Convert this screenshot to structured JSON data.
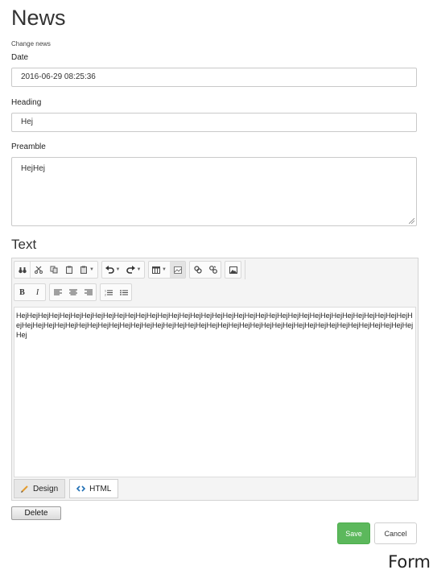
{
  "page": {
    "title": "News",
    "subtitle": "Change news"
  },
  "form": {
    "date_label": "Date",
    "date_value": "2016-06-29 08:25:36",
    "heading_label": "Heading",
    "heading_value": "Hej",
    "preamble_label": "Preamble",
    "preamble_value": "HejHej"
  },
  "editor": {
    "section_title": "Text",
    "content": "HejHejHejHejHejHejHejHejHejHejHejHejHejHejHejHejHejHejHejHejHejHejHejHejHejHejHejHejHejHejHejHejHejHejHejHejHejHejHejHejHejHejHejHejHejHejHejHejHejHejHejHejHejHejHejHejHejHejHejHejHejHejHejHejHejHejHejHejHejHejHejHejHejHej",
    "toolbar_row1": [
      "find-icon",
      "cut-icon",
      "copy-icon",
      "paste-icon",
      "paste-options-icon",
      "undo-icon",
      "redo-icon",
      "table-icon",
      "image-map-icon",
      "link-icon",
      "unlink-icon",
      "insert-image-icon"
    ],
    "toolbar_row2": [
      "bold-icon",
      "italic-icon",
      "align-left-icon",
      "align-center-icon",
      "align-right-icon",
      "ordered-list-icon",
      "unordered-list-icon"
    ],
    "bold_glyph": "B",
    "italic_glyph": "I",
    "design_tab": "Design",
    "html_tab": "HTML"
  },
  "actions": {
    "delete": "Delete",
    "save": "Save",
    "cancel": "Cancel"
  },
  "caption": "Form",
  "colors": {
    "save_bg": "#5cb85c",
    "text": "#333333",
    "border": "#c9c9c9"
  }
}
